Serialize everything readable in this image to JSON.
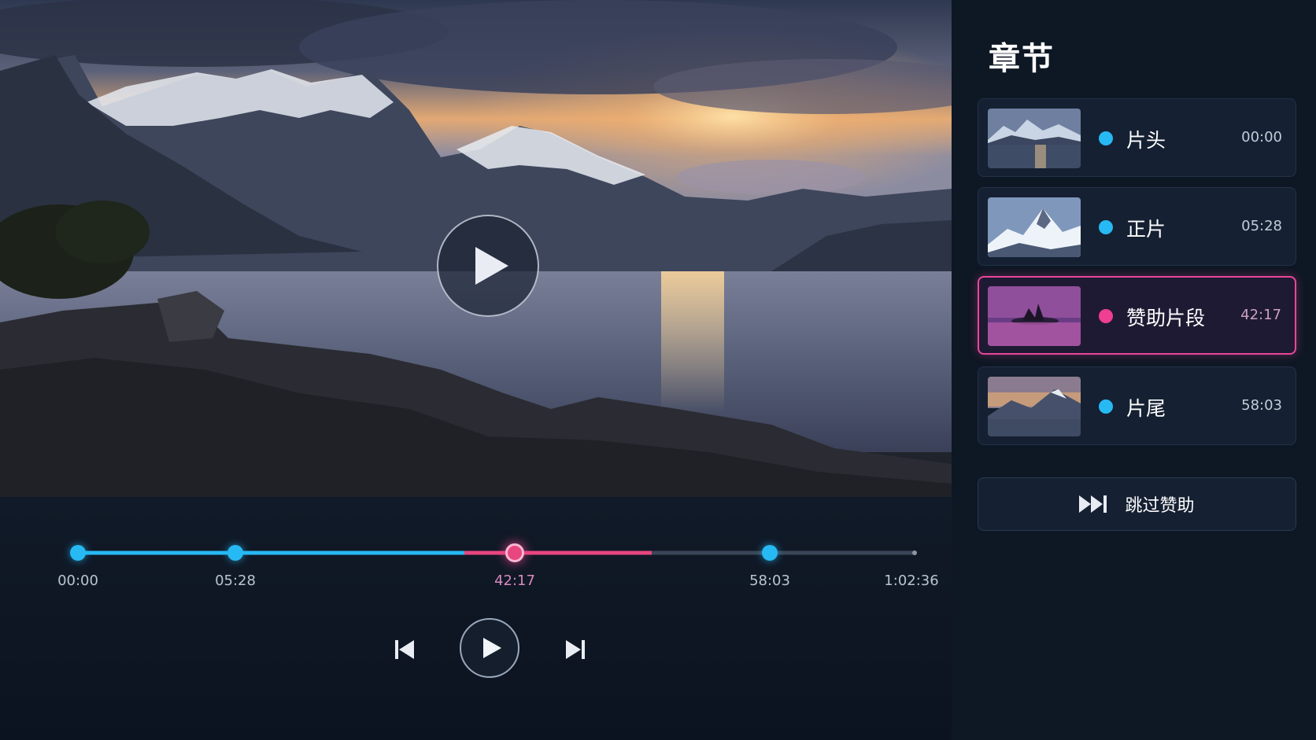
{
  "sidebar": {
    "title": "章节",
    "chapters": [
      {
        "label": "片头",
        "time": "00:00",
        "active": false
      },
      {
        "label": "正片",
        "time": "05:28",
        "active": false
      },
      {
        "label": "赞助片段",
        "time": "42:17",
        "active": true
      },
      {
        "label": "片尾",
        "time": "58:03",
        "active": false
      }
    ],
    "skip_button": {
      "label": "跳过赞助",
      "icon": "skip-forward-icon"
    }
  },
  "timeline": {
    "labels": [
      "00:00",
      "05:28",
      "42:17",
      "58:03",
      "1:02:36"
    ],
    "duration": "1:02:36",
    "current": "42:17"
  },
  "player": {
    "overlay_play_icon": "play-icon",
    "transport": {
      "previous_icon": "skip-previous-icon",
      "play_icon": "play-icon",
      "next_icon": "skip-next-icon"
    }
  },
  "colors": {
    "accent": "#27b9f3",
    "sponsor": "#e8467f",
    "background": "#0d1420",
    "panel": "#152032"
  }
}
